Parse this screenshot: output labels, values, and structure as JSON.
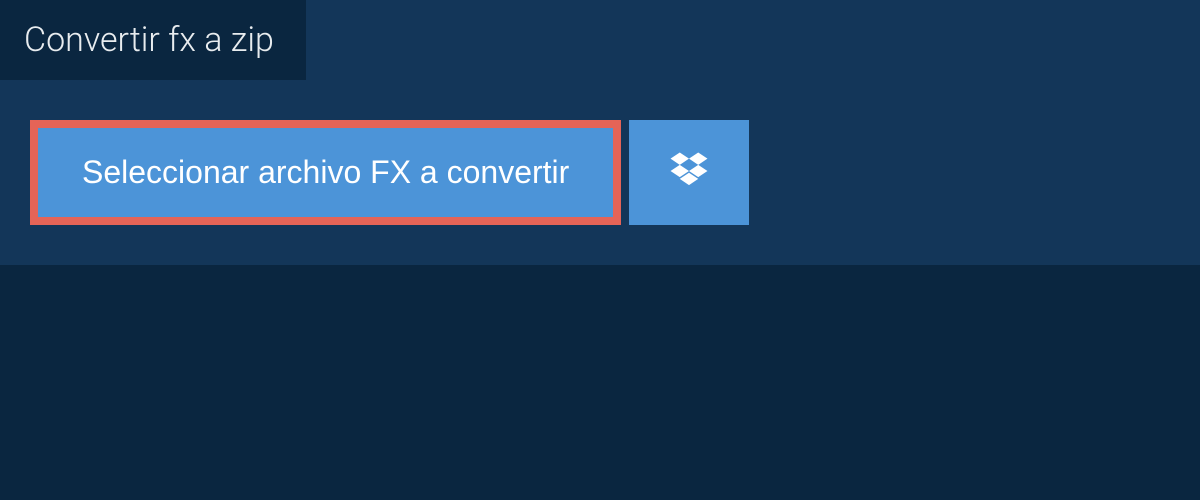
{
  "header": {
    "tab_title": "Convertir fx a zip"
  },
  "actions": {
    "select_file_label": "Seleccionar archivo FX a convertir",
    "dropbox_icon_name": "dropbox-icon"
  },
  "colors": {
    "background": "#0a2640",
    "panel": "#133659",
    "button_primary": "#4c94d8",
    "highlight_border": "#e56457",
    "text_light": "#e8ecef"
  }
}
